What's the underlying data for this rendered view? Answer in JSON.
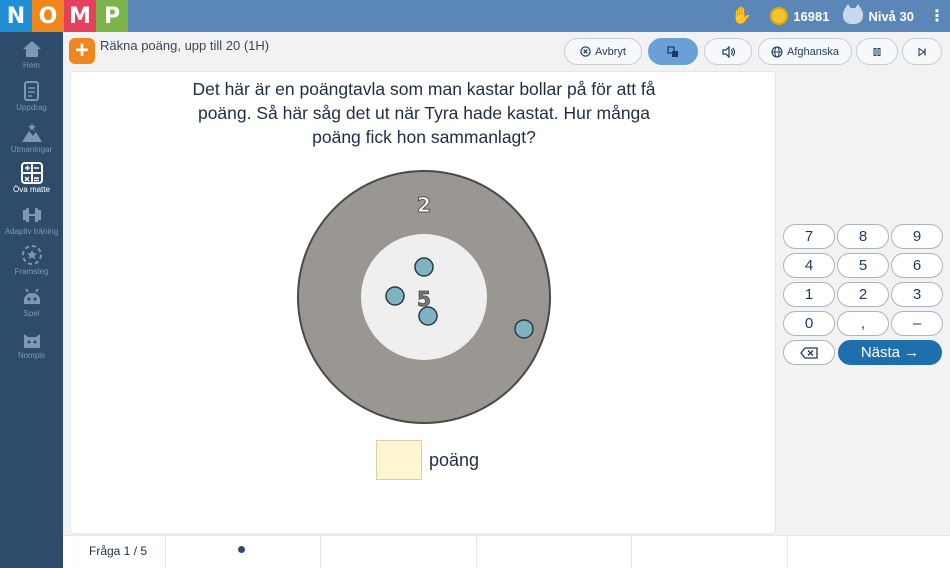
{
  "logo": [
    "N",
    "O",
    "M",
    "P"
  ],
  "logo_colors": [
    "#1f8fd6",
    "#f0861e",
    "#e6415c",
    "#7bb54a"
  ],
  "topbar": {
    "coins": "16981",
    "level": "Nivå 30",
    "hand_icon": "hand-icon",
    "coin_icon": "coin-icon",
    "cat_icon": "cat-icon"
  },
  "sidebar": {
    "items": [
      {
        "label": "Hem",
        "icon": "home-icon"
      },
      {
        "label": "Uppdrag",
        "icon": "assignment-icon"
      },
      {
        "label": "Utmaningar",
        "icon": "mountain-icon"
      },
      {
        "label": "Öva matte",
        "icon": "calculator-icon",
        "active": true
      },
      {
        "label": "Adaptiv träning",
        "icon": "dumbbell-icon"
      },
      {
        "label": "Framsteg",
        "icon": "progress-icon"
      },
      {
        "label": "Spel",
        "icon": "gamepad-icon"
      },
      {
        "label": "Nompis",
        "icon": "cat-icon"
      }
    ]
  },
  "header": {
    "task_title": "Räkna poäng, upp till 20 (1H)",
    "buttons": {
      "cancel": "Avbryt",
      "language": "Afghanska"
    }
  },
  "question": {
    "text": "Det här är en poängtavla som man kastar bollar på för att få poäng. Så här såg det ut när Tyra hade kastat. Hur många poäng fick hon sammanlagt?",
    "outer_score": "2",
    "inner_score": "5",
    "answer_value": "",
    "answer_unit": "poäng"
  },
  "keypad": {
    "keys": [
      "7",
      "8",
      "9",
      "4",
      "5",
      "6",
      "1",
      "2",
      "3",
      "0",
      ",",
      "–"
    ],
    "next": "Nästa →"
  },
  "footer": {
    "question_label": "Fråga 1 / 5",
    "current_question": 1,
    "total_questions": 5
  },
  "colors": {
    "topbar": "#5b87b8",
    "sidebar": "#2f4b6b",
    "accent": "#f0861e",
    "primary_button": "#1f6fae",
    "ball": "#7fb3c0"
  }
}
